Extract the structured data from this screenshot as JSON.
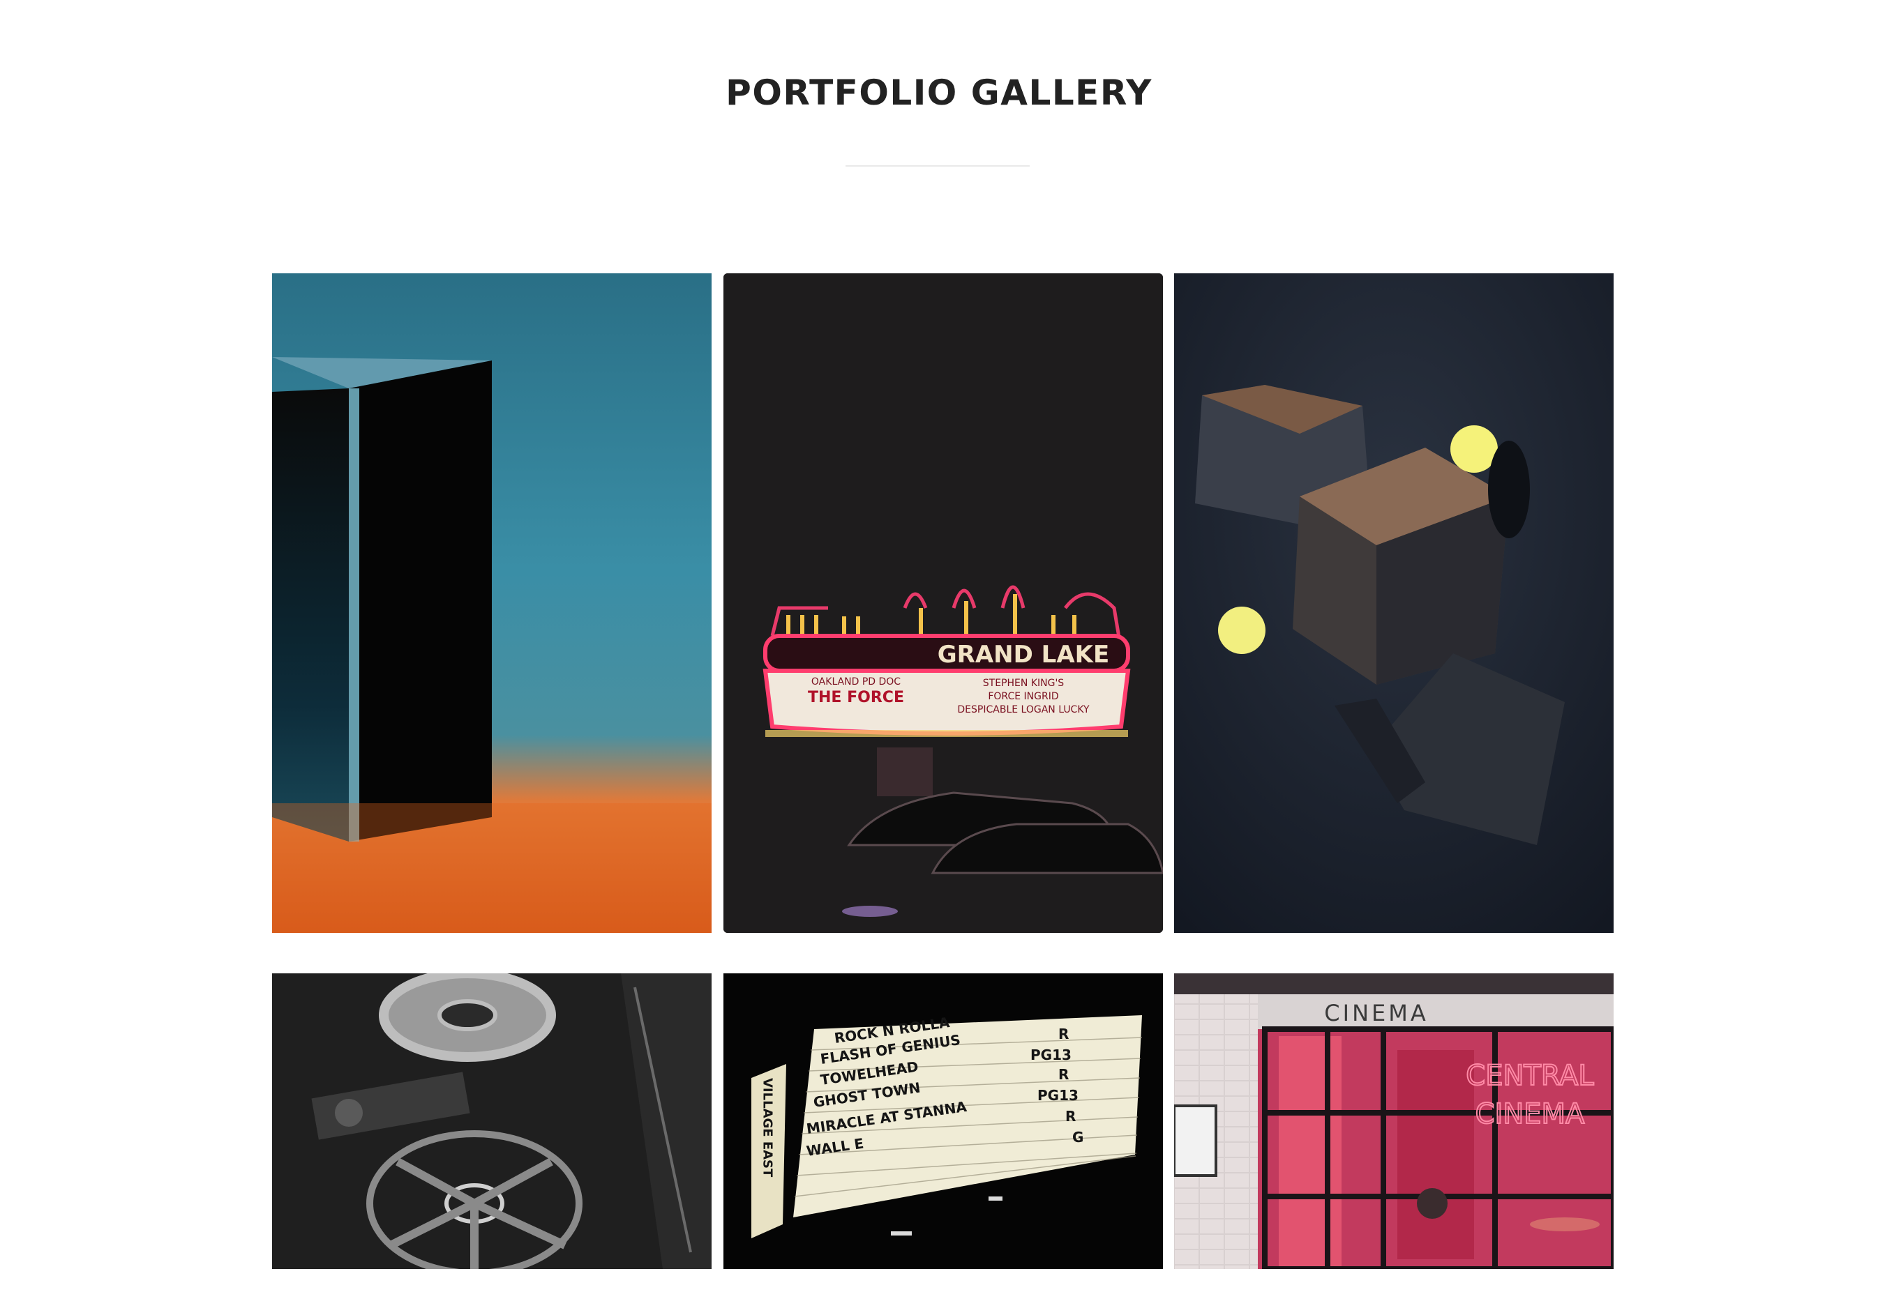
{
  "page": {
    "title": "PORTFOLIO GALLERY"
  },
  "gallery": {
    "items": [
      {
        "name": "prism",
        "icon": "prism-image"
      },
      {
        "name": "grand-lake-marquee",
        "icon": "theater-marquee-image",
        "sign": "GRAND LAKE",
        "left_lines": [
          "OAKLAND PD DOC",
          "THE FORCE"
        ],
        "right_lines": [
          "STEPHEN KING'S",
          "FORCE  INGRID",
          "DESPICABLE  LOGAN LUCKY"
        ]
      },
      {
        "name": "floating-cubes",
        "icon": "cubes-image"
      },
      {
        "name": "film-reels",
        "icon": "film-reel-image"
      },
      {
        "name": "village-east-marquee",
        "icon": "marquee-board-image",
        "side": "VILLAGE EAST",
        "lines": [
          "ROCK N ROLLA",
          "FLASH OF GENIUS",
          "TOWELHEAD",
          "GHOST TOWN",
          "MIRACLE AT STANNA",
          "WALL E"
        ],
        "ratings": [
          "R",
          "PG13",
          "R",
          "PG13",
          "R",
          "G"
        ]
      },
      {
        "name": "cinema-storefront",
        "icon": "cinema-storefront-image",
        "sign": "CINEMA",
        "neon_1": "CENTRAL",
        "neon_2": "CINEMA"
      }
    ]
  }
}
